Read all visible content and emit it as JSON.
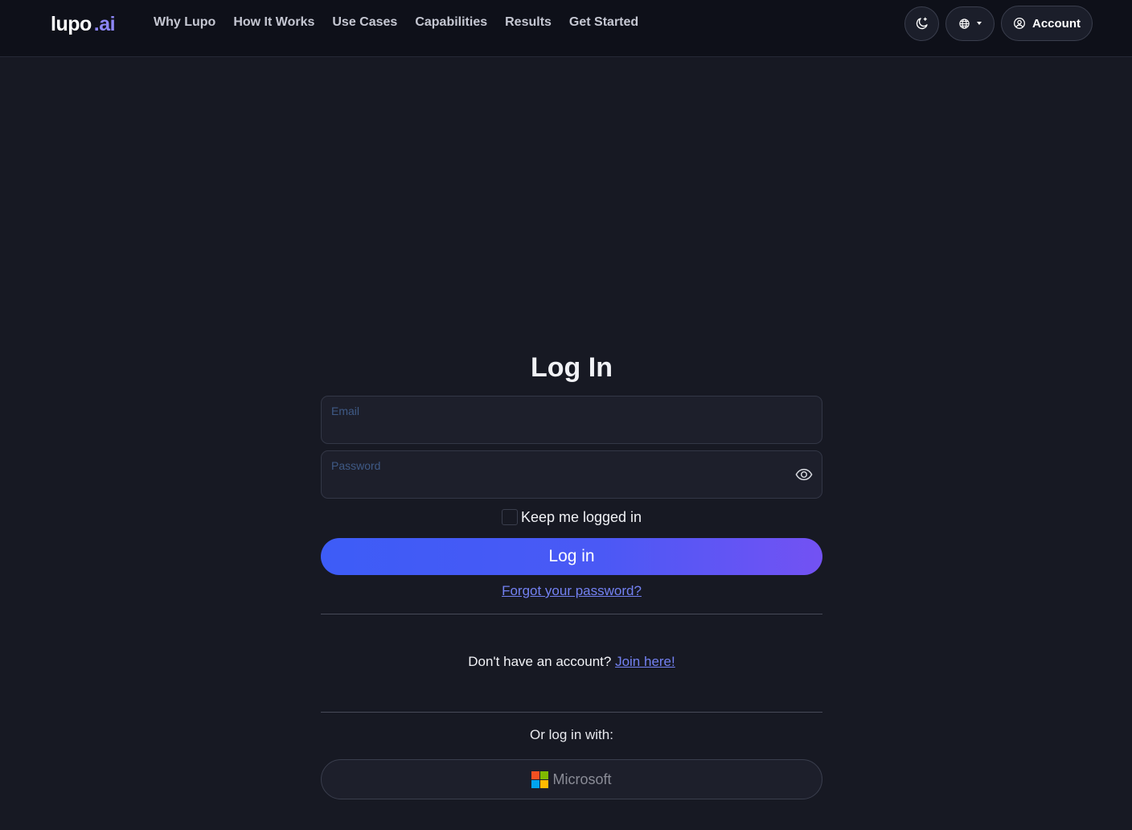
{
  "brand": {
    "name": "lupo",
    "suffix": ".ai"
  },
  "nav": {
    "links": [
      {
        "label": "Why Lupo"
      },
      {
        "label": "How It Works"
      },
      {
        "label": "Use Cases"
      },
      {
        "label": "Capabilities"
      },
      {
        "label": "Results"
      },
      {
        "label": "Get Started"
      }
    ],
    "theme_icon": "moon-icon",
    "language_icon": "globe-icon",
    "account_label": "Account"
  },
  "login": {
    "title": "Log In",
    "email": {
      "label": "Email",
      "value": ""
    },
    "password": {
      "label": "Password",
      "value": ""
    },
    "keep_logged_in": {
      "label": "Keep me logged in",
      "checked": false
    },
    "submit_label": "Log in",
    "forgot_label": "Forgot your password?",
    "signup_prompt": "Don't have an account?",
    "signup_link": "Join here!",
    "alt_prompt": "Or log in with:",
    "microsoft_label": "Microsoft"
  },
  "colors": {
    "background": "#171923",
    "navbar": "#0e1019",
    "accent_start": "#3d5cf7",
    "accent_end": "#7352f3",
    "link": "#7381f2"
  }
}
